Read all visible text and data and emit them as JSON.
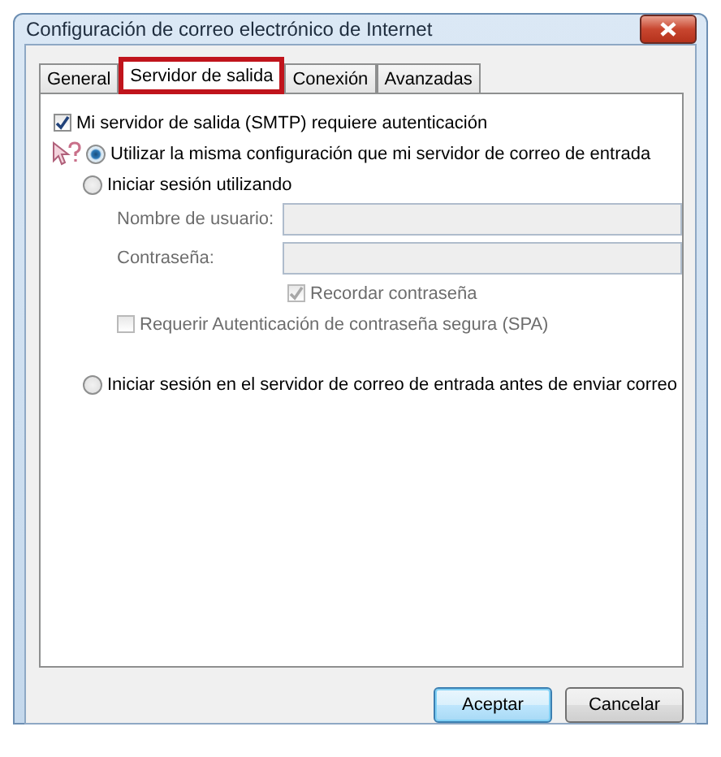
{
  "window": {
    "title": "Configuración de correo electrónico de Internet"
  },
  "tabs": [
    {
      "label": "General",
      "selected": false
    },
    {
      "label": "Servidor de salida",
      "selected": true
    },
    {
      "label": "Conexión",
      "selected": false
    },
    {
      "label": "Avanzadas",
      "selected": false
    }
  ],
  "authentication": {
    "label": "Mi servidor de salida (SMTP) requiere autenticación",
    "checked": true
  },
  "radios": [
    {
      "label": "Utilizar la misma configuración que mi servidor de correo de entrada",
      "selected": true
    },
    {
      "label": "Iniciar sesión utilizando",
      "selected": false,
      "fields": [
        {
          "label": "Nombre de usuario:",
          "disabled": true
        },
        {
          "label": "Contraseña:",
          "disabled": true
        }
      ],
      "remember": {
        "label": "Recordar contraseña",
        "checked": true,
        "disabled": true
      },
      "spa": {
        "label": "Requerir Autenticación de contraseña segura (SPA)",
        "checked": false,
        "disabled": true
      }
    },
    {
      "label": "Iniciar sesión en el servidor de correo de entrada antes de enviar correo",
      "selected": false
    }
  ],
  "buttons": [
    {
      "label": "Aceptar",
      "kind": "default"
    },
    {
      "label": "Cancelar",
      "kind": "normal"
    }
  ]
}
